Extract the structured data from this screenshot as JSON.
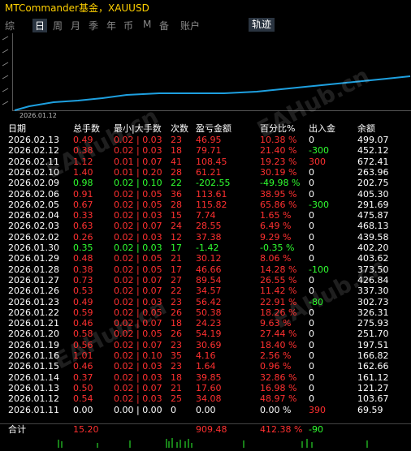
{
  "title": "MTCommander基金，XAUUSD",
  "tabs": [
    {
      "label": "综"
    },
    {
      "label": "日",
      "active": true
    },
    {
      "label": "周"
    },
    {
      "label": "月"
    },
    {
      "label": "季"
    },
    {
      "label": "年"
    },
    {
      "label": "币"
    },
    {
      "label": "M"
    },
    {
      "label": "备"
    },
    {
      "label": "账户"
    }
  ],
  "track_tab": "轨迹",
  "chart_date": "2026.01.12",
  "watermark": "EAHub.cn",
  "colors": {
    "positive": "#30ff30",
    "negative": "#ff3030",
    "line": "#1ea0e0"
  },
  "headers": {
    "date": "日期",
    "total": "总手数",
    "size": "最小|大手数",
    "count": "次数",
    "pnl": "盈亏金额",
    "pct": "百分比%",
    "dep": "出入金",
    "bal": "余额"
  },
  "rows": [
    [
      "2026.02.13",
      "0.49",
      "0.02 | 0.03",
      "23",
      "46.95",
      "10.38 %",
      "0",
      "499.07",
      "r"
    ],
    [
      "2026.02.12",
      "0.38",
      "0.02 | 0.03",
      "18",
      "79.71",
      "21.40 %",
      "-300",
      "452.12",
      "r"
    ],
    [
      "2026.02.11",
      "1.12",
      "0.01 | 0.07",
      "41",
      "108.45",
      "19.23 %",
      "300",
      "672.41",
      "r"
    ],
    [
      "2026.02.10",
      "1.40",
      "0.01 | 0.20",
      "28",
      "61.21",
      "30.19 %",
      "0",
      "263.96",
      "r"
    ],
    [
      "2026.02.09",
      "0.98",
      "0.02 | 0.10",
      "22",
      "-202.55",
      "-49.98 %",
      "0",
      "202.75",
      "g"
    ],
    [
      "2026.02.06",
      "0.91",
      "0.02 | 0.05",
      "36",
      "113.61",
      "38.95 %",
      "0",
      "405.30",
      "r"
    ],
    [
      "2026.02.05",
      "0.67",
      "0.02 | 0.05",
      "28",
      "115.82",
      "65.86 %",
      "-300",
      "291.69",
      "r"
    ],
    [
      "2026.02.04",
      "0.33",
      "0.02 | 0.03",
      "15",
      "7.74",
      "1.65 %",
      "0",
      "475.87",
      "r"
    ],
    [
      "2026.02.03",
      "0.63",
      "0.02 | 0.07",
      "24",
      "28.55",
      "6.49 %",
      "0",
      "468.13",
      "r"
    ],
    [
      "2026.02.02",
      "0.26",
      "0.02 | 0.03",
      "12",
      "37.38",
      "9.29 %",
      "0",
      "439.58",
      "r"
    ],
    [
      "2026.01.30",
      "0.35",
      "0.02 | 0.03",
      "17",
      "-1.42",
      "-0.35 %",
      "0",
      "402.20",
      "g"
    ],
    [
      "2026.01.29",
      "0.48",
      "0.02 | 0.05",
      "21",
      "30.12",
      "8.06 %",
      "0",
      "403.62",
      "r"
    ],
    [
      "2026.01.28",
      "0.38",
      "0.02 | 0.05",
      "17",
      "46.66",
      "14.28 %",
      "-100",
      "373.50",
      "r"
    ],
    [
      "2026.01.27",
      "0.73",
      "0.02 | 0.07",
      "27",
      "89.54",
      "26.55 %",
      "0",
      "426.84",
      "r"
    ],
    [
      "2026.01.26",
      "0.53",
      "0.02 | 0.07",
      "22",
      "34.57",
      "11.42 %",
      "0",
      "337.30",
      "r"
    ],
    [
      "2026.01.23",
      "0.49",
      "0.02 | 0.03",
      "23",
      "56.42",
      "22.91 %",
      "-80",
      "302.73",
      "r"
    ],
    [
      "2026.01.22",
      "0.59",
      "0.02 | 0.05",
      "26",
      "50.38",
      "18.26 %",
      "0",
      "326.31",
      "r"
    ],
    [
      "2026.01.21",
      "0.46",
      "0.02 | 0.07",
      "18",
      "24.23",
      "9.63 %",
      "0",
      "275.93",
      "r"
    ],
    [
      "2026.01.20",
      "0.58",
      "0.02 | 0.05",
      "26",
      "54.19",
      "27.44 %",
      "0",
      "251.70",
      "r"
    ],
    [
      "2026.01.19",
      "0.56",
      "0.02 | 0.07",
      "23",
      "30.69",
      "18.40 %",
      "0",
      "197.51",
      "r"
    ],
    [
      "2026.01.16",
      "1.01",
      "0.02 | 0.10",
      "35",
      "4.16",
      "2.56 %",
      "0",
      "166.82",
      "r"
    ],
    [
      "2026.01.15",
      "0.46",
      "0.02 | 0.03",
      "23",
      "1.64",
      "0.96 %",
      "0",
      "162.66",
      "r"
    ],
    [
      "2026.01.14",
      "0.37",
      "0.02 | 0.03",
      "18",
      "39.85",
      "32.86 %",
      "0",
      "161.12",
      "r"
    ],
    [
      "2026.01.13",
      "0.50",
      "0.02 | 0.07",
      "21",
      "17.60",
      "16.98 %",
      "0",
      "121.27",
      "r"
    ],
    [
      "2026.01.12",
      "0.54",
      "0.02 | 0.03",
      "25",
      "34.08",
      "48.97 %",
      "0",
      "103.67",
      "r"
    ],
    [
      "2026.01.11",
      "0.00",
      "0.00 | 0.00",
      "0",
      "0.00",
      "0.00 %",
      "390",
      "69.59",
      "w"
    ]
  ],
  "footer": {
    "label": "合计",
    "total": "15.20",
    "pnl": "909.48",
    "pct": "412.38 %",
    "dep": "-90"
  }
}
